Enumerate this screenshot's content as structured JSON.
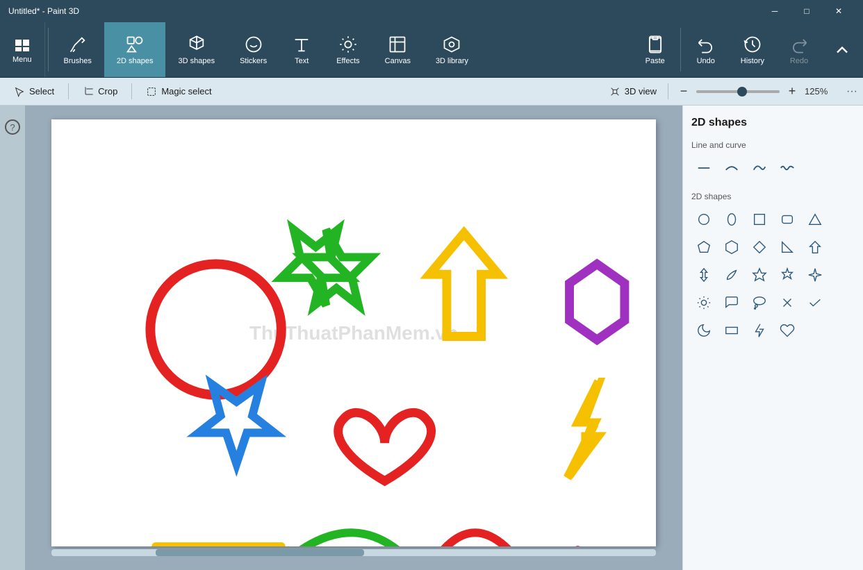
{
  "titlebar": {
    "title": "Untitled* - Paint 3D",
    "min_label": "─",
    "max_label": "□",
    "close_label": "✕"
  },
  "toolbar": {
    "menu_label": "Menu",
    "tools": [
      {
        "id": "brushes",
        "label": "Brushes"
      },
      {
        "id": "2dshapes",
        "label": "2D shapes"
      },
      {
        "id": "3dshapes",
        "label": "3D shapes"
      },
      {
        "id": "stickers",
        "label": "Stickers"
      },
      {
        "id": "text",
        "label": "Text"
      },
      {
        "id": "effects",
        "label": "Effects"
      },
      {
        "id": "canvas",
        "label": "Canvas"
      },
      {
        "id": "3dlibrary",
        "label": "3D library"
      }
    ],
    "actions": [
      {
        "id": "paste",
        "label": "Paste"
      },
      {
        "id": "undo",
        "label": "Undo"
      },
      {
        "id": "history",
        "label": "History"
      },
      {
        "id": "redo",
        "label": "Redo"
      }
    ]
  },
  "subbar": {
    "select_label": "Select",
    "crop_label": "Crop",
    "magic_select_label": "Magic select",
    "view_3d_label": "3D view",
    "zoom_percent": "125%",
    "more_label": "···"
  },
  "panel": {
    "title": "2D shapes",
    "line_curve_title": "Line and curve",
    "shapes_title": "2D shapes"
  },
  "watermark": "ThuThuatPhanMem.vn"
}
